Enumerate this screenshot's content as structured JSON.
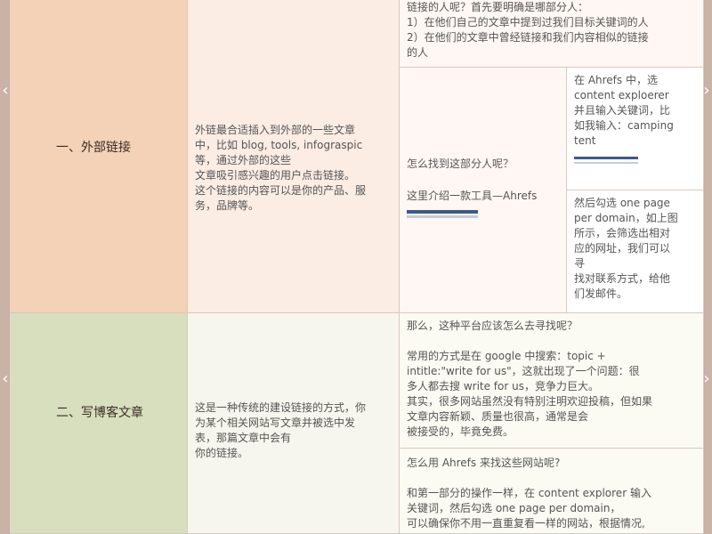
{
  "sections": [
    {
      "title": "一、外部链接",
      "description": "外链最合适插入到外部的一些文章\n中，比如 blog, tools, infograspic\n等，通过外部的这些\n文章吸引感兴趣的用户点击链接。\n这个链接的内容可以是你的产品、服\n务，品牌等。",
      "top_note": "链接的人呢？首先要明确是哪部分人：\n1）在他们自己的文章中提到过我们目标关键词的人\n2）在他们的文章中曾经链接和我们内容相似的链接\n的人",
      "find_people": "怎么找到这部分人呢？",
      "tool_intro": "这里介绍一款工具—Ahrefs",
      "step_one": "在 Ahrefs 中，选\ncontent exploerer\n并且输入关键词，比\n如我输入：camping\ntent",
      "step_two": "然后勾选 one page\nper domain，如上图\n所示，会筛选出相对\n应的网址，我们可以\n寻\n找对联系方式，给他\n们发邮件。"
    },
    {
      "title": "二、写博客文章",
      "description": "这是一种传统的建设链接的方式，你\n为某个相关网站写文章并被选中发\n表，那篇文章中会有\n你的链接。",
      "question": "那么，这种平台应该怎么去寻找呢？",
      "method": "常用的方式是在 google 中搜索：topic +\nintitle:\"write for us\"，这就出现了一个问题：很\n多人都去搜 write for us，竞争力巨大。\n其实，很多网站虽然没有特别注明欢迎投稿，但如果\n文章内容新颖、质量也很高，通常是会\n被接受的，毕竟免费。",
      "ahrefs_question": "怎么用 Ahrefs 来找这些网站呢?",
      "ahrefs_method": "和第一部分的操作一样，在 content explorer 输入\n关键词，然后勾选 one page per domain，\n可以确保你不用一直重复看一样的网站，根据情况,"
    }
  ],
  "colors": {
    "section_one": "#f3d2b7",
    "section_two": "#d8dfbf"
  }
}
